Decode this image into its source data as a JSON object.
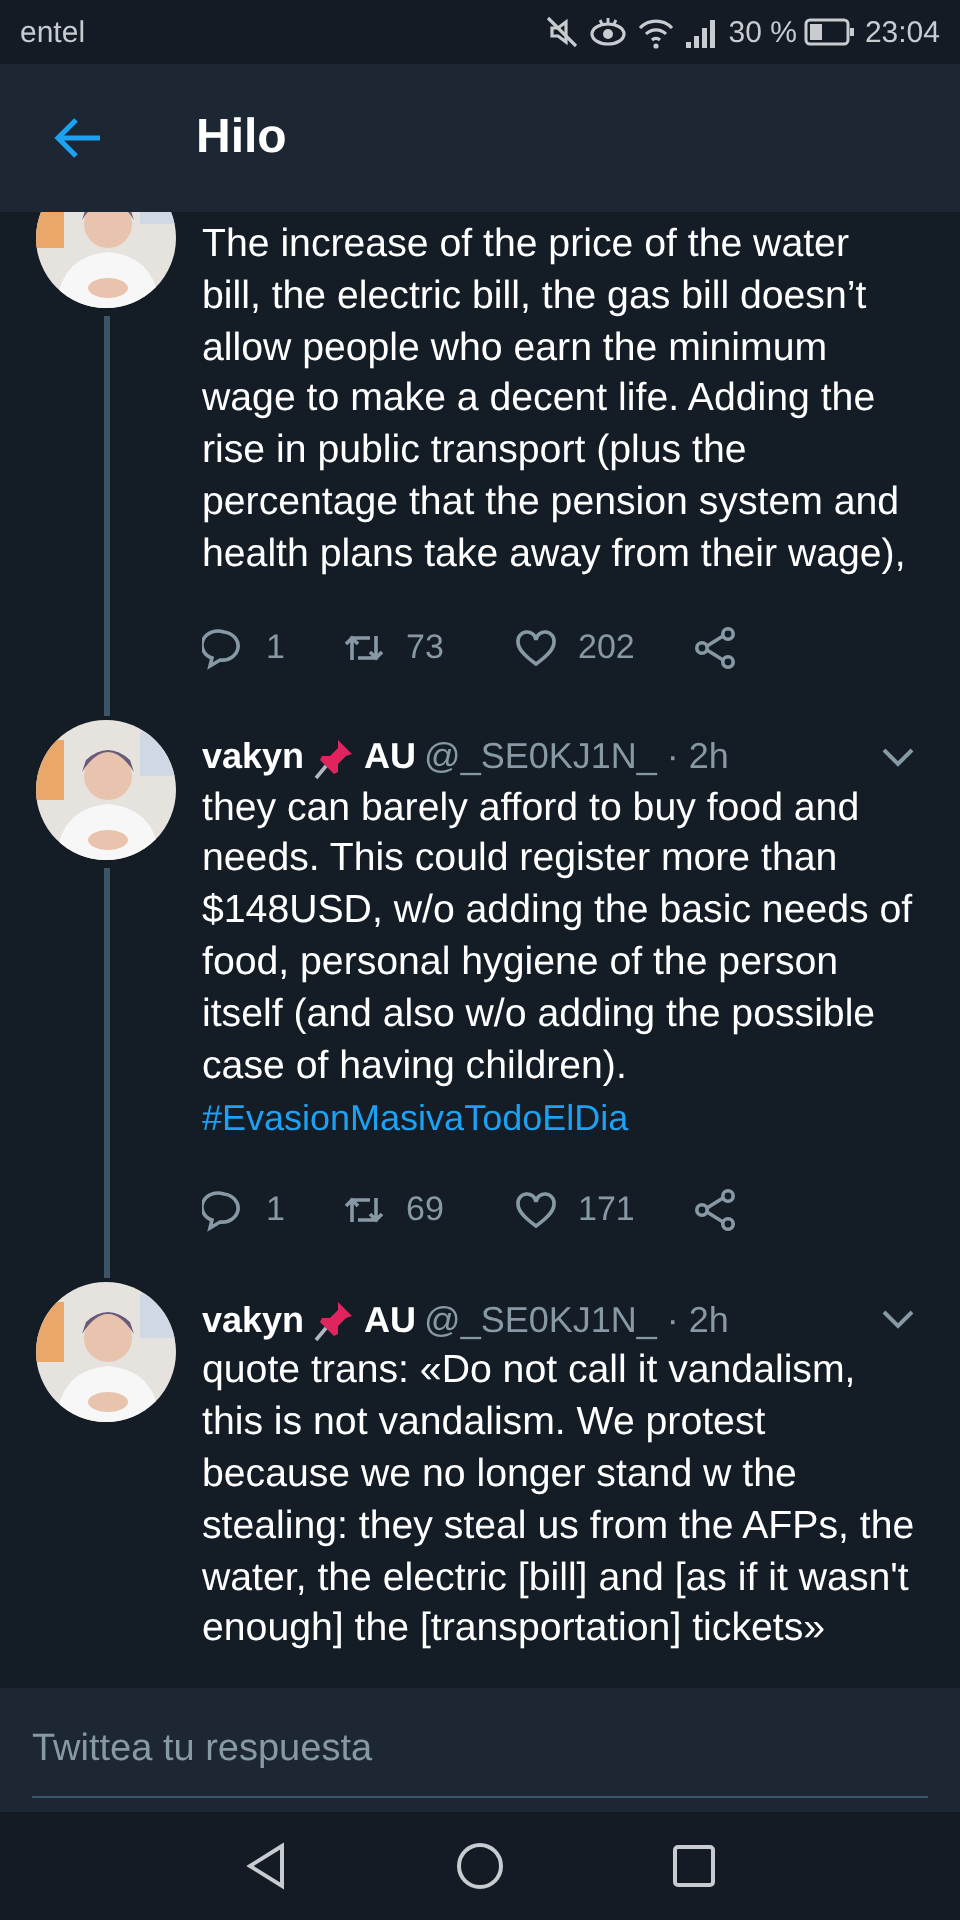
{
  "status_bar": {
    "carrier": "entel",
    "battery": "30 %",
    "time": "23:04"
  },
  "header": {
    "title": "Hilo"
  },
  "tweets": [
    {
      "text": "The increase of the price of the water bill, the electric bill, the gas bill doesn’t allow people who earn the minimum wage to make a decent life. Adding the rise in public transport (plus the percentage that the pension system and health plans take away from their wage),",
      "actions": {
        "replies": "1",
        "retweets": "73",
        "likes": "202"
      }
    },
    {
      "name": "vakyn",
      "suffix": "AU",
      "handle": "@_SE0KJ1N_ · 2h",
      "text": "they can barely afford to buy food and needs. This could register more than $148USD, w/o adding the basic needs of food, personal hygiene of the person itself (and also w/o adding the possible case of having children).",
      "hashtag": "#EvasionMasivaTodoElDia",
      "actions": {
        "replies": "1",
        "retweets": "69",
        "likes": "171"
      }
    },
    {
      "name": "vakyn",
      "suffix": "AU",
      "handle": "@_SE0KJ1N_ · 2h",
      "text": "quote trans: «Do not call it vandalism, this is not vandalism. We protest because we no longer stand w the stealing: they steal us from the AFPs, the water, the electric [bill] and [as if it wasn't enough] the [transportation] tickets»"
    }
  ],
  "reply_box": {
    "placeholder": "Twittea tu respuesta"
  }
}
